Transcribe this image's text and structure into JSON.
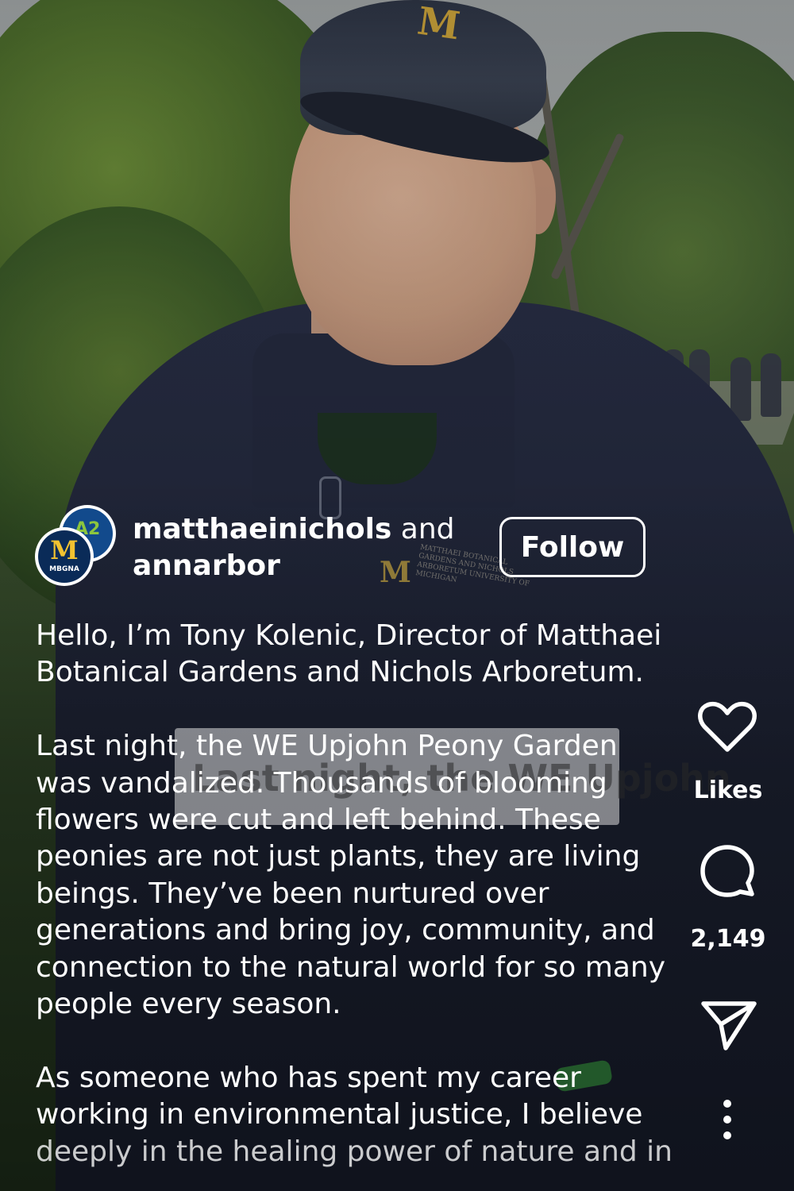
{
  "post": {
    "author_primary": "matthaeinichols",
    "author_joiner": " and",
    "author_secondary": "annarbor",
    "avatar_primary": {
      "letter": "M",
      "tag": "MBGNA"
    },
    "avatar_secondary": {
      "text": "A2"
    },
    "follow_label": "Follow",
    "video_subtitle": "Last night, the WE Upjohn"
  },
  "caption": {
    "lines": [
      "Hello, I’m Tony Kolenic, Director of Matthaei",
      "Botanical Gardens and Nichols Arboretum.",
      "",
      "Last night, the WE Upjohn Peony Garden",
      "was vandalized. Thousands of blooming",
      "flowers were cut and left behind. These",
      "peonies are not just plants, they are living",
      "beings. They’ve been nurtured over",
      "generations and bring joy, community, and",
      "connection to the natural world for so many",
      "people every season.",
      "",
      "As someone who has spent my career",
      "working in environmental justice, I believe",
      "deeply in the healing power of nature and in"
    ]
  },
  "actions": {
    "like_label": "Likes",
    "comment_count": "2,149"
  },
  "icons": {
    "like": "heart-icon",
    "comment": "comment-bubble-icon",
    "share": "send-icon",
    "more": "more-vertical-icon"
  },
  "colors": {
    "text": "#ffffff",
    "avatar_navy": "#0a2b58",
    "avatar_maize": "#f2c230"
  }
}
